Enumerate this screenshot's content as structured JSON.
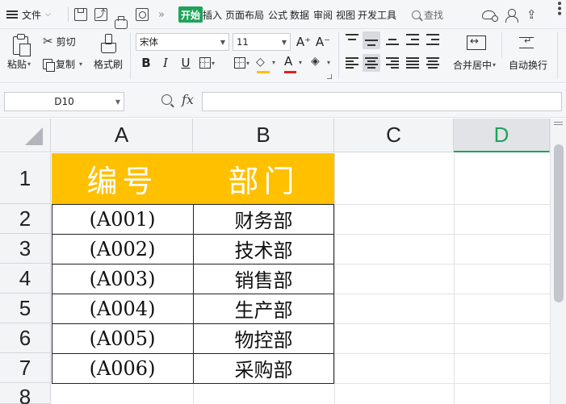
{
  "menubar": {
    "file_label": "文件",
    "tabs": [
      "开始",
      "插入",
      "页面布局",
      "公式",
      "数据",
      "审阅",
      "视图",
      "开发工具"
    ],
    "search_label": "查找"
  },
  "ribbon": {
    "paste": "粘贴",
    "cut": "剪切",
    "copy": "复制",
    "format_painter": "格式刷",
    "font_name": "宋体",
    "font_size": "11",
    "grow_font": "A⁺",
    "shrink_font": "A⁻",
    "bold": "B",
    "italic": "I",
    "underline": "U",
    "font_color_letter": "A",
    "merge_center": "合并居中",
    "wrap_text": "自动换行"
  },
  "formula_bar": {
    "name_box": "D10",
    "fx": "fx",
    "formula": ""
  },
  "sheet": {
    "columns": [
      "A",
      "B",
      "C",
      "D"
    ],
    "selected_column": "D",
    "rows": [
      "1",
      "2",
      "3",
      "4",
      "5",
      "6",
      "7",
      "8"
    ],
    "header_row": [
      "编号",
      "部门"
    ],
    "data": [
      [
        "(A001)",
        "财务部"
      ],
      [
        "(A002)",
        "技术部"
      ],
      [
        "(A003)",
        "销售部"
      ],
      [
        "(A004)",
        "生产部"
      ],
      [
        "(A005)",
        "物控部"
      ],
      [
        "(A006)",
        "采购部"
      ]
    ]
  },
  "colors": {
    "accent_green": "#1fa35a",
    "header_fill": "#ffc000",
    "font_color": "#e02020",
    "fill_color": "#ffc000"
  }
}
